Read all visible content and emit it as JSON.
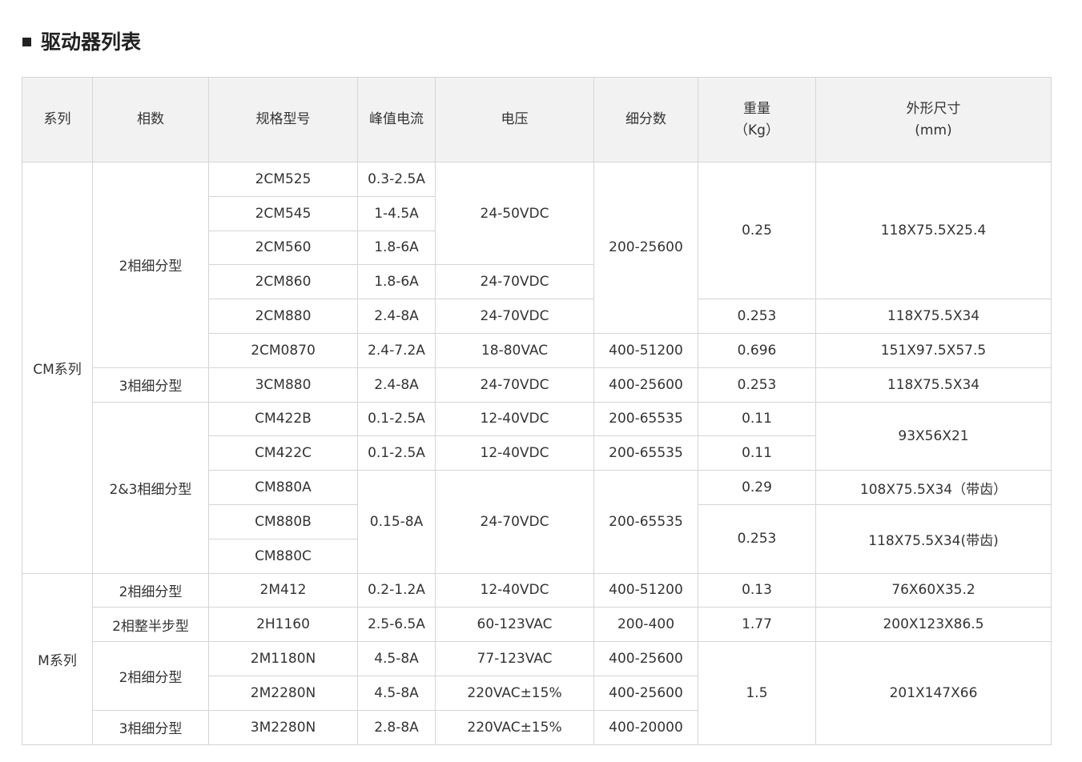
{
  "page_title": "驱动器列表",
  "table": {
    "headers": {
      "series": "系列",
      "phases": "相数",
      "model": "规格型号",
      "peak_current": "峰值电流",
      "voltage": "电压",
      "microstep": "细分数",
      "weight_line1": "重量",
      "weight_line2": "（Kg）",
      "size_line1": "外形尺寸",
      "size_line2": "(mm)"
    },
    "series": {
      "cm": "CM系列",
      "m": "M系列"
    },
    "phases": {
      "cm_2phase": "2相细分型",
      "cm_3phase": "3相细分型",
      "cm_2and3phase": "2&3相细分型",
      "m_2phase_a": "2相细分型",
      "m_2phase_halfstep": "2相整半步型",
      "m_2phase_b": "2相细分型",
      "m_3phase": "3相细分型"
    },
    "rows": [
      {
        "model": "2CM525",
        "current": "0.3-2.5A",
        "voltage": "24-50VDC",
        "microstep": "200-25600",
        "weight": "0.25",
        "size": "118X75.5X25.4"
      },
      {
        "model": "2CM545",
        "current": "1-4.5A"
      },
      {
        "model": "2CM560",
        "current": "1.8-6A"
      },
      {
        "model": "2CM860",
        "current": "1.8-6A",
        "voltage": "24-70VDC"
      },
      {
        "model": "2CM880",
        "current": "2.4-8A",
        "voltage": "24-70VDC",
        "weight": "0.253",
        "size": "118X75.5X34"
      },
      {
        "model": "2CM0870",
        "current": "2.4-7.2A",
        "voltage": "18-80VAC",
        "microstep": "400-51200",
        "weight": "0.696",
        "size": "151X97.5X57.5"
      },
      {
        "model": "3CM880",
        "current": "2.4-8A",
        "voltage": "24-70VDC",
        "microstep": "400-25600",
        "weight": "0.253",
        "size": "118X75.5X34"
      },
      {
        "model": "CM422B",
        "current": "0.1-2.5A",
        "voltage": "12-40VDC",
        "microstep": "200-65535",
        "weight": "0.11",
        "size": "93X56X21"
      },
      {
        "model": "CM422C",
        "current": "0.1-2.5A",
        "voltage": "12-40VDC",
        "microstep": "200-65535",
        "weight": "0.11"
      },
      {
        "model": "CM880A",
        "current": "0.15-8A",
        "voltage": "24-70VDC",
        "microstep": "200-65535",
        "weight": "0.29",
        "size": "108X75.5X34（带齿）"
      },
      {
        "model": "CM880B",
        "weight": "0.253",
        "size": "118X75.5X34(带齿)"
      },
      {
        "model": "CM880C"
      },
      {
        "model": "2M412",
        "current": "0.2-1.2A",
        "voltage": "12-40VDC",
        "microstep": "400-51200",
        "weight": "0.13",
        "size": "76X60X35.2"
      },
      {
        "model": "2H1160",
        "current": "2.5-6.5A",
        "voltage": "60-123VAC",
        "microstep": "200-400",
        "weight": "1.77",
        "size": "200X123X86.5"
      },
      {
        "model": "2M1180N",
        "current": "4.5-8A",
        "voltage": "77-123VAC",
        "microstep": "400-25600",
        "weight": "1.5",
        "size": "201X147X66"
      },
      {
        "model": "2M2280N",
        "current": "4.5-8A",
        "voltage": "220VAC±15%",
        "microstep": "400-25600"
      },
      {
        "model": "3M2280N",
        "current": "2.8-8A",
        "voltage": "220VAC±15%",
        "microstep": "400-20000"
      }
    ]
  }
}
